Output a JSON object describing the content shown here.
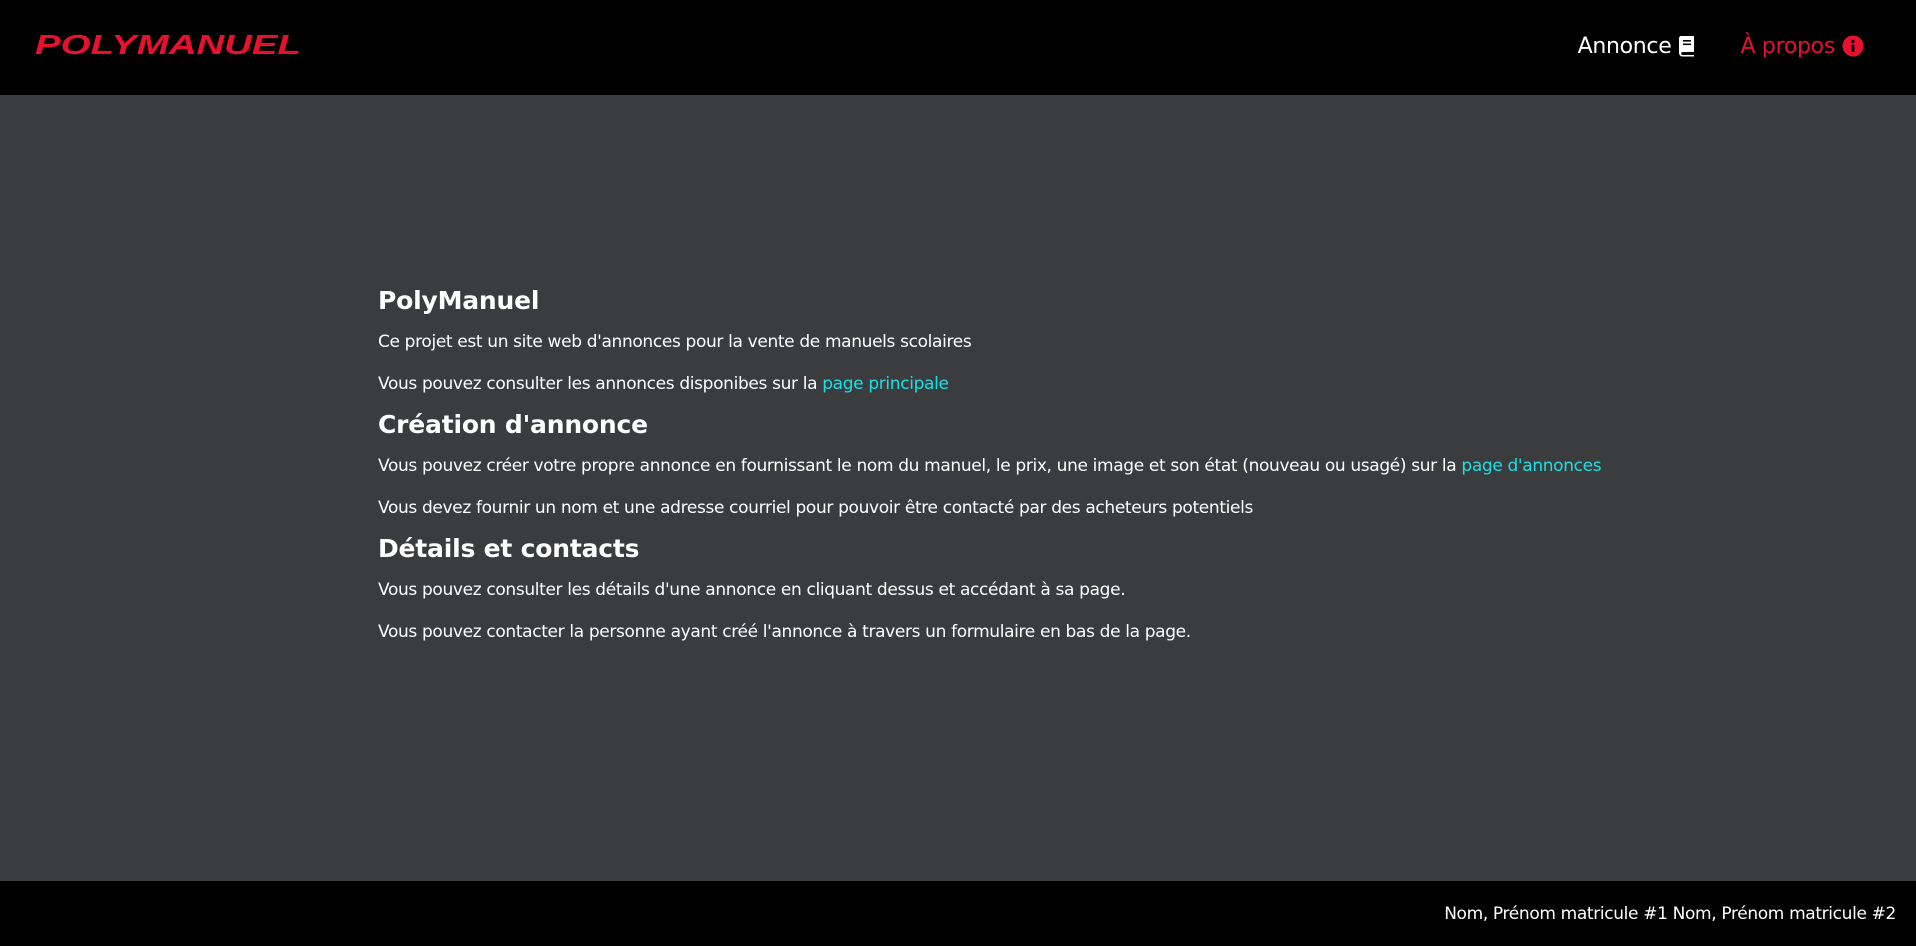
{
  "colors": {
    "header_bg": "#000000",
    "page_bg": "#3b3c3e",
    "brand_red": "#e8112d",
    "link_cyan": "#19e0e5",
    "text": "#ffffff"
  },
  "header": {
    "logo_text": "POLYMANUEL",
    "nav": [
      {
        "label": "Annonce",
        "icon": "book-icon",
        "active": false
      },
      {
        "label": "À propos",
        "icon": "info-icon",
        "active": true
      }
    ]
  },
  "main": {
    "sections": [
      {
        "title": "PolyManuel",
        "paragraphs": [
          {
            "text": "Ce projet est un site web d'annonces pour la vente de manuels scolaires"
          },
          {
            "text": "Vous pouvez consulter les annonces disponibes sur la ",
            "link": "page principale"
          }
        ]
      },
      {
        "title": "Création d'annonce",
        "paragraphs": [
          {
            "text": "Vous pouvez créer votre propre annonce en fournissant le nom du manuel, le prix, une image et son état (nouveau ou usagé) sur la ",
            "link": "page d'annonces"
          },
          {
            "text": "Vous devez fournir un nom et une adresse courriel pour pouvoir être contacté par des acheteurs potentiels"
          }
        ]
      },
      {
        "title": "Détails et contacts",
        "paragraphs": [
          {
            "text": "Vous pouvez consulter les détails d'une annonce en cliquant dessus et accédant à sa page."
          },
          {
            "text": "Vous pouvez contacter la personne ayant créé l'annonce à travers un formulaire en bas de la page."
          }
        ]
      }
    ]
  },
  "footer": {
    "credits": "Nom, Prénom matricule #1 Nom, Prénom matricule #2"
  }
}
